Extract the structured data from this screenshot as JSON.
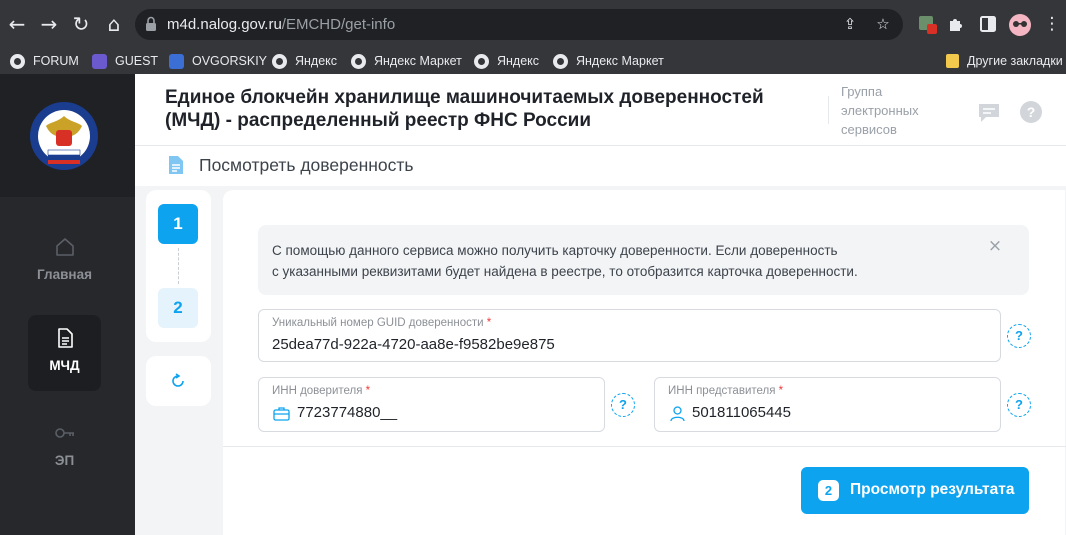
{
  "browser": {
    "url_host": "m4d.nalog.gov.ru",
    "url_path": "/EMCHD/get-info",
    "bookmarks": [
      {
        "label": "FORUM",
        "icon": "globe-icon"
      },
      {
        "label": "GUEST",
        "icon": "extension-app-icon"
      },
      {
        "label": "OVGORSKIY",
        "icon": "extension-app-icon"
      },
      {
        "label": "Яндекс",
        "icon": "globe-icon"
      },
      {
        "label": "Яндекс Маркет",
        "icon": "globe-icon"
      },
      {
        "label": "Яндекс",
        "icon": "globe-icon"
      },
      {
        "label": "Яндекс Маркет",
        "icon": "globe-icon"
      }
    ],
    "other_bookmarks": "Другие закладки"
  },
  "sidebar": {
    "items": [
      {
        "label": "Главная",
        "icon": "home-icon",
        "active": false
      },
      {
        "label": "МЧД",
        "icon": "document-icon",
        "active": true
      },
      {
        "label": "ЭП",
        "icon": "key-icon",
        "active": false
      }
    ]
  },
  "header": {
    "title": "Единое блокчейн хранилище машиночитаемых доверенностей (МЧД) - распределенный реестр ФНС России",
    "group": "Группа электронных сервисов"
  },
  "page": {
    "title": "Посмотреть доверенность"
  },
  "stepper": {
    "steps": [
      "1",
      "2"
    ],
    "current": 1
  },
  "info": {
    "text_line1": "С помощью данного сервиса можно получить карточку доверенности. Если доверенность",
    "text_line2": "с указанными реквизитами будет найдена в реестре, то отобразится карточка доверенности."
  },
  "form": {
    "guid": {
      "label": "Уникальный номер GUID доверенности",
      "required": "*",
      "value": "25dea77d-922a-4720-aa8e-f9582be9e875"
    },
    "inn_principal": {
      "label": "ИНН доверителя",
      "required": "*",
      "value": "7723774880__"
    },
    "inn_representative": {
      "label": "ИНН представителя",
      "required": "*",
      "value": "501811065445"
    },
    "help_symbol": "?"
  },
  "submit": {
    "step_badge": "2",
    "label": "Просмотр результата"
  },
  "colors": {
    "accent": "#0da3ef",
    "sidebar_bg": "#26282c",
    "required": "#ef3b3b"
  }
}
